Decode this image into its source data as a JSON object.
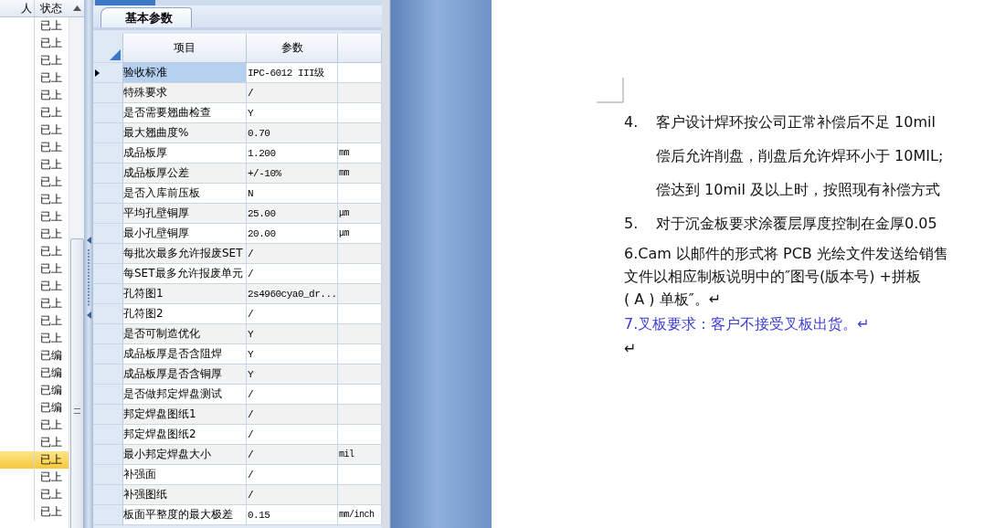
{
  "list_panel": {
    "columns": [
      "人",
      "状态"
    ],
    "rows": [
      {
        "status": "已上",
        "selected": false
      },
      {
        "status": "已上",
        "selected": false
      },
      {
        "status": "已上",
        "selected": false
      },
      {
        "status": "已上",
        "selected": false
      },
      {
        "status": "已上",
        "selected": false
      },
      {
        "status": "已上",
        "selected": false
      },
      {
        "status": "已上",
        "selected": false
      },
      {
        "status": "已上",
        "selected": false
      },
      {
        "status": "已上",
        "selected": false
      },
      {
        "status": "已上",
        "selected": false
      },
      {
        "status": "已上",
        "selected": false
      },
      {
        "status": "已上",
        "selected": false
      },
      {
        "status": "已上",
        "selected": false
      },
      {
        "status": "已上",
        "selected": false
      },
      {
        "status": "已上",
        "selected": false
      },
      {
        "status": "已上",
        "selected": false
      },
      {
        "status": "已上",
        "selected": false
      },
      {
        "status": "已上",
        "selected": false
      },
      {
        "status": "已上",
        "selected": false
      },
      {
        "status": "已编",
        "selected": false
      },
      {
        "status": "已编",
        "selected": false
      },
      {
        "status": "已编",
        "selected": false
      },
      {
        "status": "已编",
        "selected": false
      },
      {
        "status": "已上",
        "selected": false
      },
      {
        "status": "已上",
        "selected": false
      },
      {
        "status": "已上",
        "selected": true
      },
      {
        "status": "已上",
        "selected": false
      },
      {
        "status": "已上",
        "selected": false
      },
      {
        "status": "已上",
        "selected": false
      }
    ]
  },
  "params_panel": {
    "tabs": [
      {
        "label": "基本参数",
        "selected": true
      }
    ],
    "columns": [
      "项目",
      "参数"
    ],
    "rows": [
      {
        "item": "验收标准",
        "value": "IPC-6012 III级",
        "unit": "",
        "selected": true
      },
      {
        "item": "特殊要求",
        "value": "/",
        "unit": "",
        "selected": false
      },
      {
        "item": "是否需要翘曲检查",
        "value": "Y",
        "unit": "",
        "selected": false
      },
      {
        "item": "最大翘曲度%",
        "value": "0.70",
        "unit": "",
        "selected": false
      },
      {
        "item": "成品板厚",
        "value": "1.200",
        "unit": "mm",
        "selected": false
      },
      {
        "item": "成品板厚公差",
        "value": "+/-10%",
        "unit": "mm",
        "selected": false
      },
      {
        "item": "是否入库前压板",
        "value": "N",
        "unit": "",
        "selected": false
      },
      {
        "item": "平均孔壁铜厚",
        "value": "25.00",
        "unit": "μm",
        "selected": false
      },
      {
        "item": "最小孔壁铜厚",
        "value": "20.00",
        "unit": "μm",
        "selected": false
      },
      {
        "item": "每批次最多允许报废SET",
        "value": "/",
        "unit": "",
        "selected": false
      },
      {
        "item": "每SET最多允许报废单元",
        "value": "/",
        "unit": "",
        "selected": false
      },
      {
        "item": "孔符图1",
        "value": "2s4960cya0_dr...",
        "unit": "",
        "selected": false
      },
      {
        "item": "孔符图2",
        "value": "/",
        "unit": "",
        "selected": false
      },
      {
        "item": "是否可制造优化",
        "value": "Y",
        "unit": "",
        "selected": false
      },
      {
        "item": "成品板厚是否含阻焊",
        "value": "Y",
        "unit": "",
        "selected": false
      },
      {
        "item": "成品板厚是否含铜厚",
        "value": "Y",
        "unit": "",
        "selected": false
      },
      {
        "item": "是否做邦定焊盘测试",
        "value": "/",
        "unit": "",
        "selected": false
      },
      {
        "item": "邦定焊盘图纸1",
        "value": "/",
        "unit": "",
        "selected": false
      },
      {
        "item": "邦定焊盘图纸2",
        "value": "/",
        "unit": "",
        "selected": false
      },
      {
        "item": "最小邦定焊盘大小",
        "value": "/",
        "unit": "mil",
        "selected": false
      },
      {
        "item": "补强面",
        "value": "/",
        "unit": "",
        "selected": false
      },
      {
        "item": "补强图纸",
        "value": "/",
        "unit": "",
        "selected": false
      },
      {
        "item": "板面平整度的最大极差",
        "value": "0.15",
        "unit": "mm/inch",
        "selected": false
      }
    ]
  },
  "document": {
    "paragraphs": [
      {
        "number": "4.",
        "kind": "numbered",
        "lines": [
          "客户设计焊环按公司正常补偿后不足 10mil",
          "偿后允许削盘，削盘后允许焊环小于 10MIL;",
          "偿达到 10mil 及以上时，按照现有补偿方式"
        ]
      },
      {
        "number": "5.",
        "kind": "numbered",
        "lines": [
          "对于沉金板要求涂覆层厚度控制在金厚0.05"
        ]
      },
      {
        "kind": "plain",
        "lines": [
          "6.Cam 以邮件的形式将 PCB 光绘文件发送给销售",
          "文件以相应制板说明中的″图号(版本号) +拼板",
          "( A ) 单板″。↵"
        ]
      },
      {
        "kind": "highlight",
        "lines": [
          "7.叉板要求：客户不接受叉板出货。↵"
        ]
      },
      {
        "kind": "plain",
        "lines": [
          "↵"
        ]
      }
    ]
  }
}
